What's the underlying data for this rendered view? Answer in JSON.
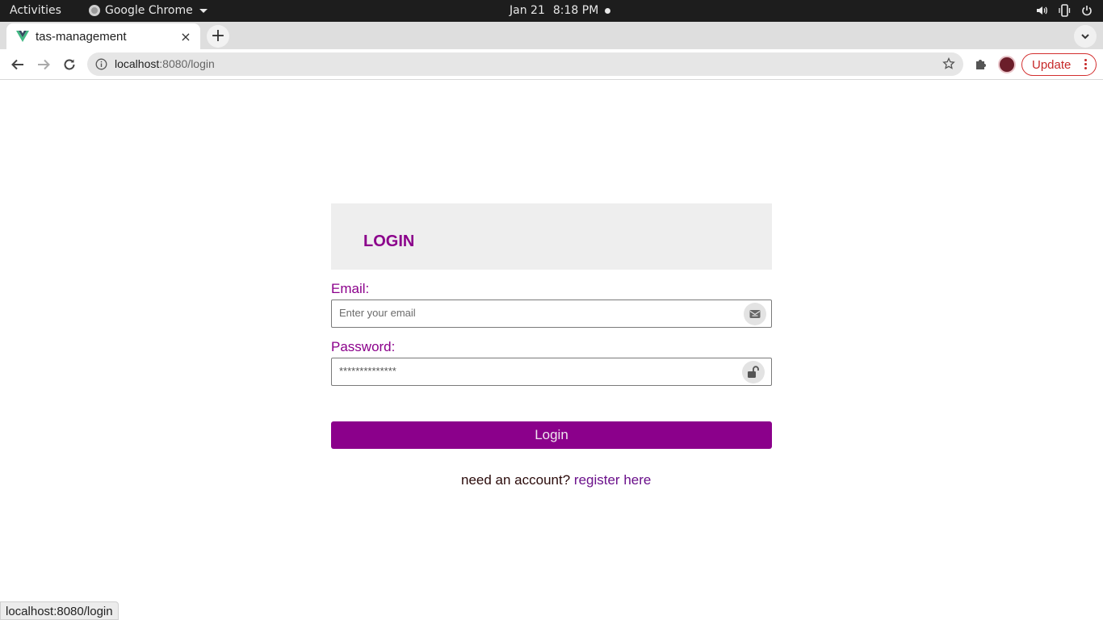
{
  "system_bar": {
    "activities": "Activities",
    "app_name": "Google Chrome",
    "date": "Jan 21",
    "time": "8:18 PM"
  },
  "browser": {
    "tab_title": "tas-management",
    "tab_close": "×",
    "new_tab": "+",
    "url_host": "localhost",
    "url_path": ":8080/login",
    "update_label": "Update",
    "status_url": "localhost:8080/login"
  },
  "login": {
    "title": "LOGIN",
    "email_label": "Email:",
    "email_placeholder": "Enter your email",
    "password_label": "Password:",
    "password_value": "**************",
    "submit_label": "Login",
    "signup_text": "need an account?",
    "signup_link": "register here"
  },
  "colors": {
    "accent": "#8b008b",
    "header_bg": "#eeeeee"
  }
}
